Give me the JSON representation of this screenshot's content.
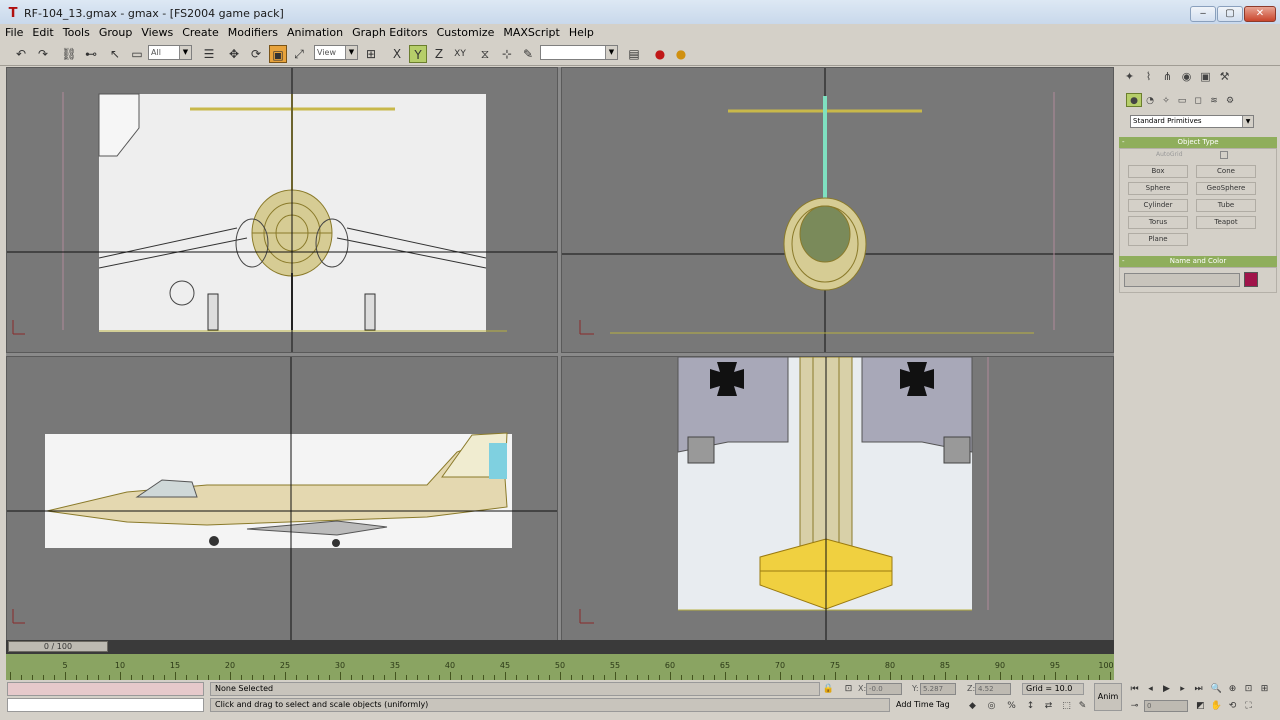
{
  "window": {
    "title": "RF-104_13.gmax - gmax - [FS2004 game pack]",
    "minimize": "‒",
    "maximize": "▢",
    "close": "✕"
  },
  "menu": [
    "File",
    "Edit",
    "Tools",
    "Group",
    "Views",
    "Create",
    "Modifiers",
    "Animation",
    "Graph Editors",
    "Customize",
    "MAXScript",
    "Help"
  ],
  "toolbar": {
    "selection_filter": "All",
    "reference_coord": "View",
    "named_selection": ""
  },
  "viewports": {
    "front": {
      "background": "#787878"
    },
    "top": {
      "background": "#787878"
    },
    "left": {
      "background": "#787878"
    },
    "perspective": {
      "background": "#787878"
    }
  },
  "timeline": {
    "slider_label": "0 / 100",
    "ticks": [
      "5",
      "10",
      "15",
      "20",
      "25",
      "30",
      "35",
      "40",
      "45",
      "50",
      "55",
      "60",
      "65",
      "70",
      "75",
      "80",
      "85",
      "90",
      "95",
      "100"
    ]
  },
  "status": {
    "selection": "None Selected",
    "prompt": "Click and drag to select and scale objects (uniformly)",
    "x_label": "X:",
    "y_label": "Y:",
    "z_label": "Z:",
    "x_value": "-0.0",
    "y_value": "5.287",
    "z_value": "4.52",
    "grid": "Grid = 10.0",
    "add_time_tag": "Add Time Tag",
    "anim_button": "Anim",
    "frame_value": "0"
  },
  "command_panel": {
    "primitive_category": "Standard Primitives",
    "object_type_title": "Object Type",
    "autogrid_label": "AutoGrid",
    "buttons": [
      "Box",
      "Cone",
      "Sphere",
      "GeoSphere",
      "Cylinder",
      "Tube",
      "Torus",
      "Teapot",
      "Plane"
    ],
    "name_color_title": "Name and Color",
    "object_color": "#a0144a"
  },
  "colors": {
    "accent_active": "#e8a33c",
    "timeline_green": "#8aa462",
    "rollout_green": "#8fae5c"
  }
}
